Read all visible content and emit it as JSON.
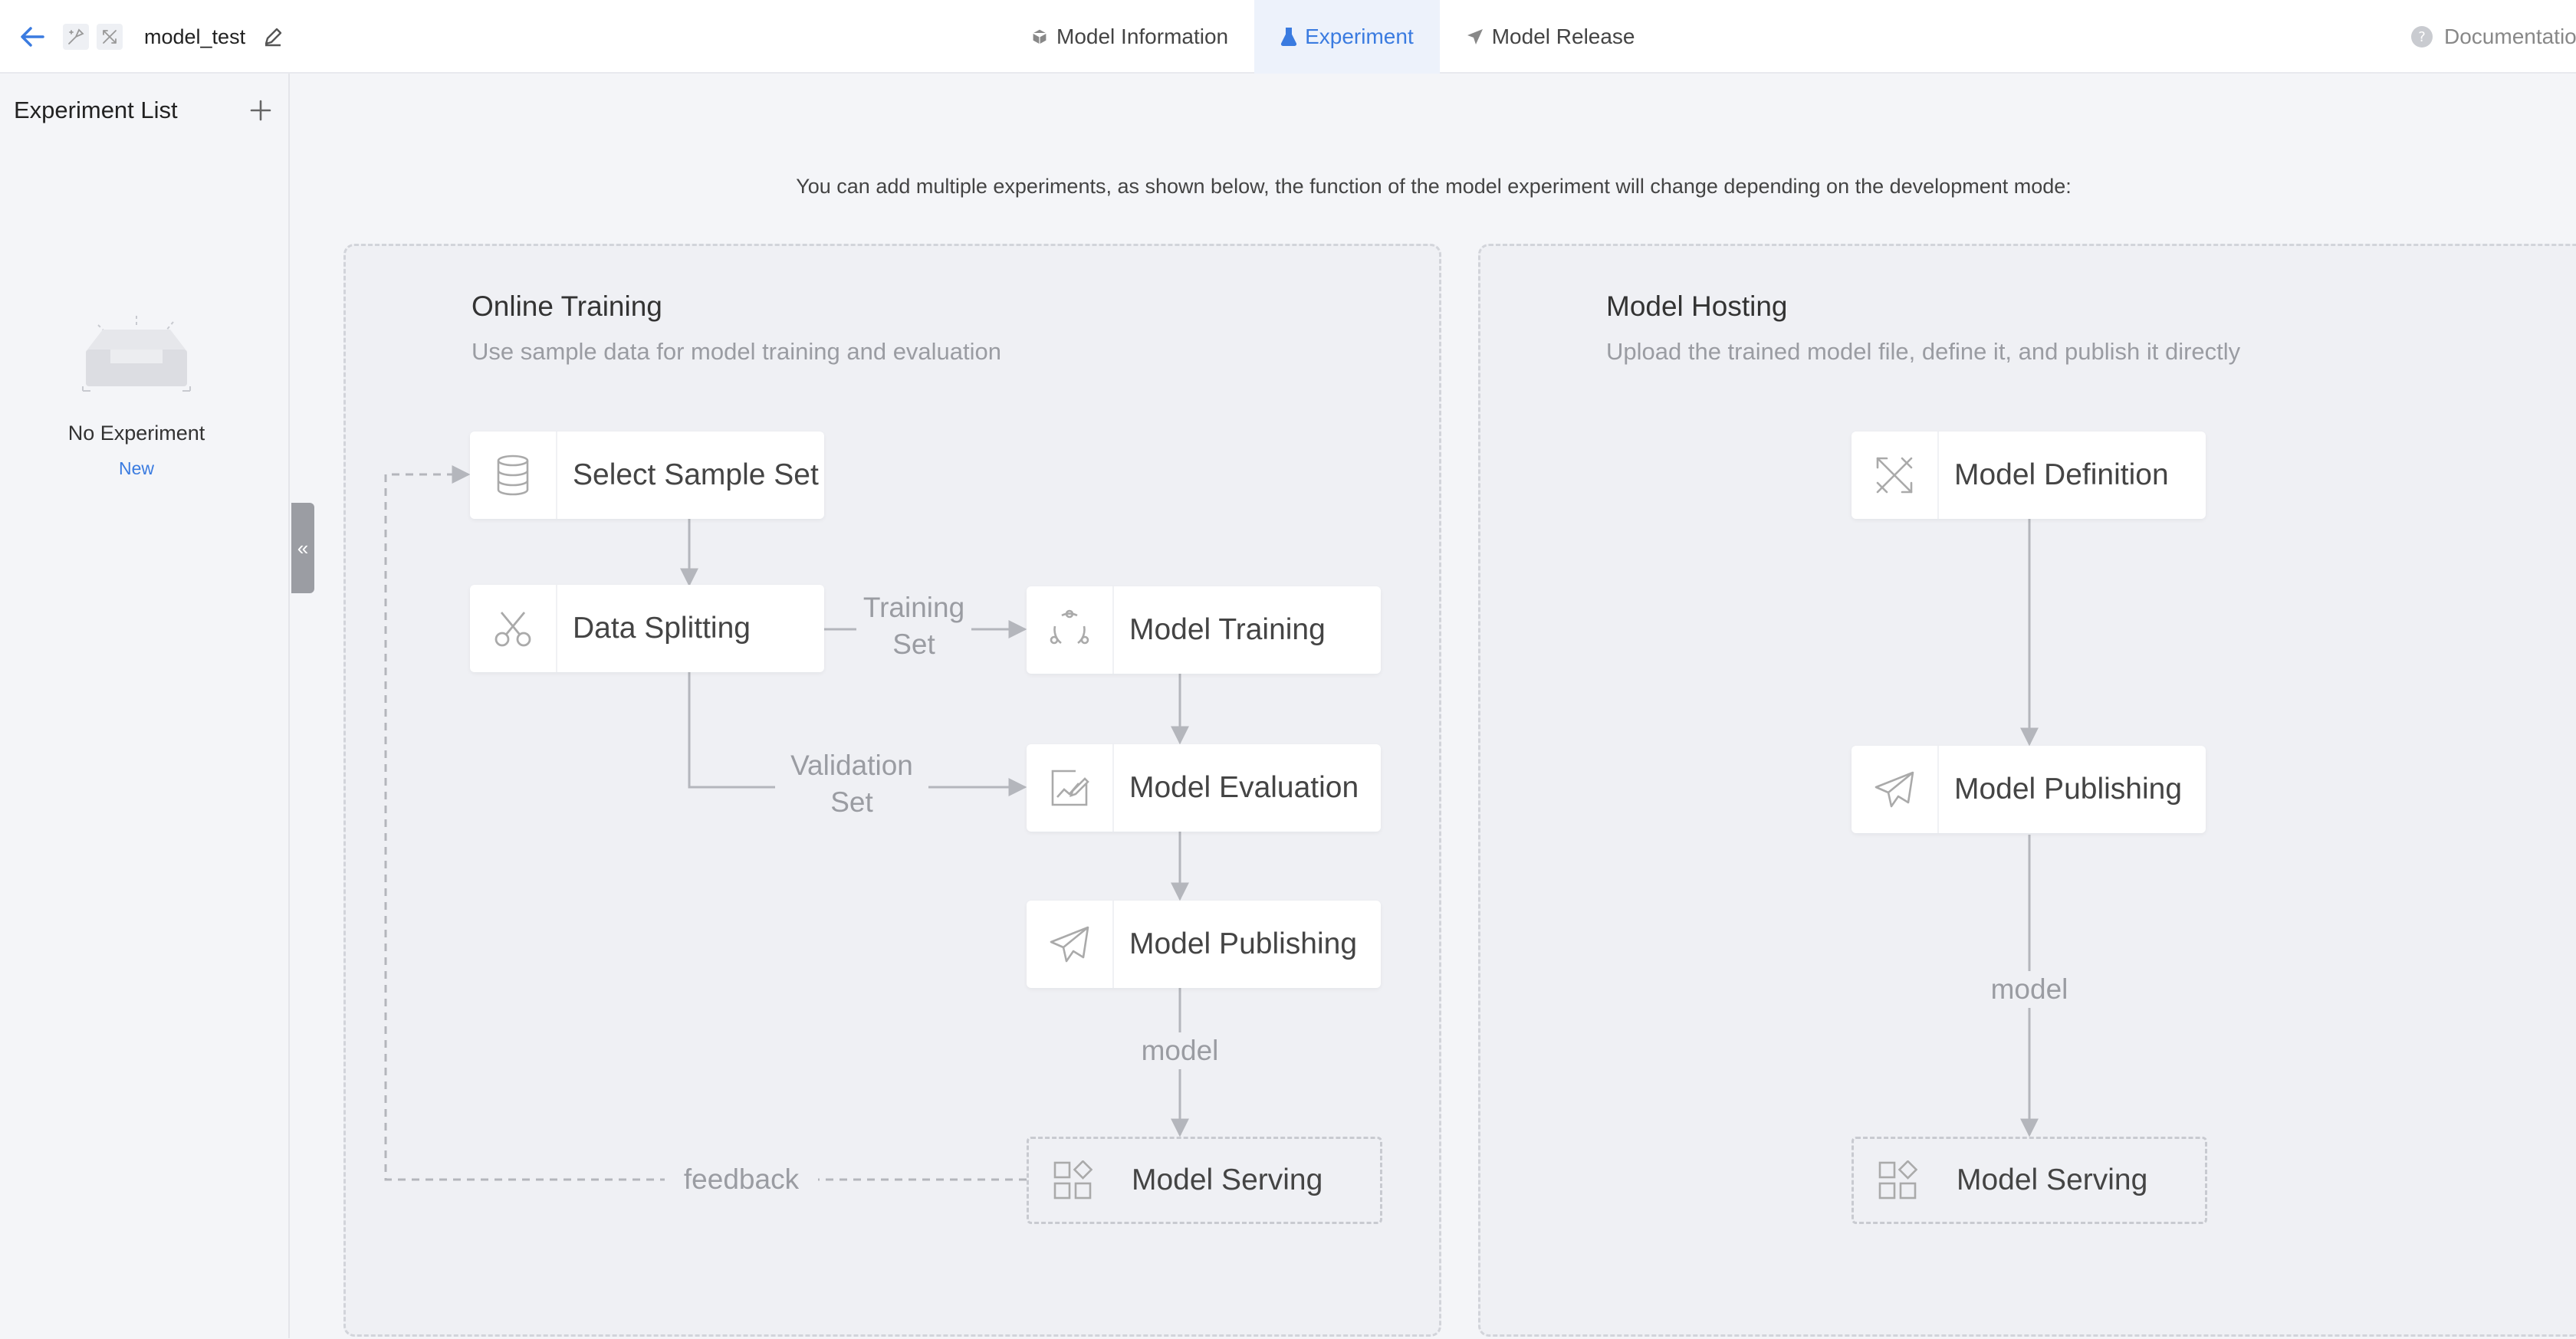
{
  "header": {
    "model_name": "model_test",
    "tabs": [
      {
        "label": "Model Information",
        "active": false
      },
      {
        "label": "Experiment",
        "active": true
      },
      {
        "label": "Model Release",
        "active": false
      }
    ],
    "doc_link": "Documentatio"
  },
  "sidebar": {
    "title": "Experiment List",
    "empty_text": "No Experiment",
    "new_link": "New",
    "collapse_glyph": "«"
  },
  "main": {
    "intro": "You can add multiple experiments, as shown below, the function of the model experiment will change depending on the development mode:",
    "online_training": {
      "title": "Online Training",
      "subtitle": "Use sample data for model training and evaluation",
      "nodes": {
        "select_sample_set": "Select Sample Set",
        "data_splitting": "Data Splitting",
        "model_training": "Model Training",
        "model_evaluation": "Model Evaluation",
        "model_publishing": "Model Publishing",
        "model_serving": "Model Serving"
      },
      "edge_labels": {
        "training_set": "Training\nSet",
        "validation_set": "Validation\nSet",
        "model": "model",
        "feedback": "feedback"
      }
    },
    "model_hosting": {
      "title": "Model Hosting",
      "subtitle": "Upload the trained model file, define it, and publish it directly",
      "nodes": {
        "model_definition": "Model Definition",
        "model_publishing": "Model Publishing",
        "model_serving": "Model Serving"
      },
      "edge_labels": {
        "model": "model"
      }
    }
  },
  "colors": {
    "accent": "#3a7be0",
    "panel_bg": "#eff0f4",
    "page_bg": "#f4f5f8",
    "line": "#b4b6bc"
  }
}
